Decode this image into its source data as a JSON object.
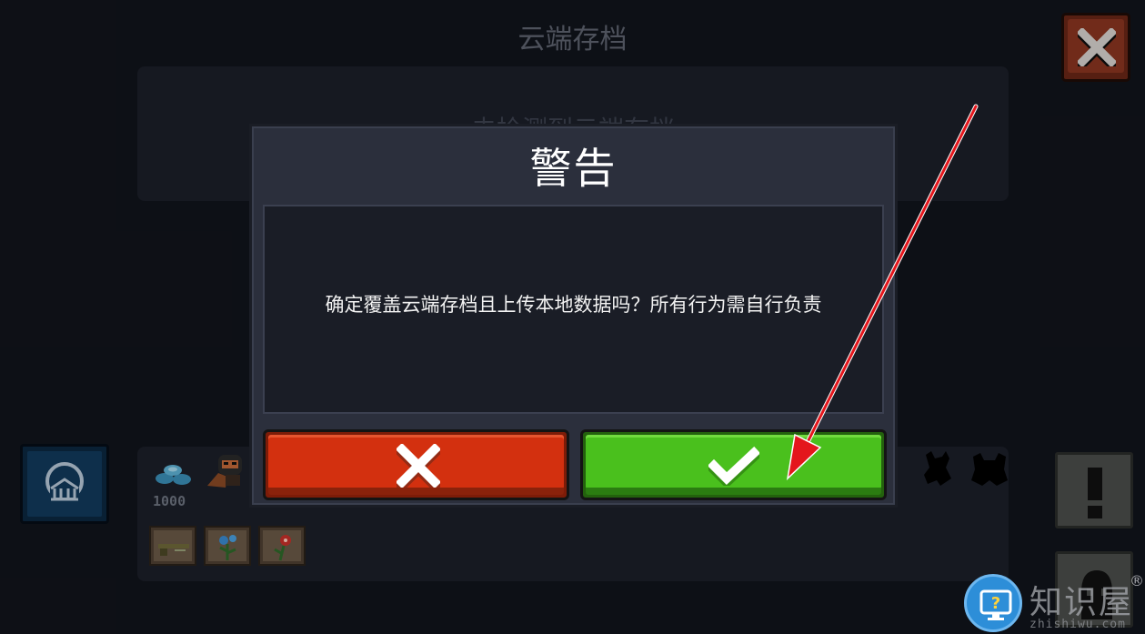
{
  "background": {
    "title": "云端存档",
    "top_panel_text": "未检测到云端存档",
    "gems_count": "1000",
    "close_icon": "close-icon",
    "side_buttons": [
      "exclamation-icon",
      "ghost-icon"
    ]
  },
  "dialog": {
    "title": "警告",
    "message": "确定覆盖云端存档且上传本地数据吗？所有行为需自行负责",
    "cancel_icon": "x-icon",
    "confirm_icon": "checkmark-icon"
  },
  "annotation": {
    "arrow_color": "#e4161c"
  },
  "watermark": {
    "text": "知识屋",
    "reg": "®",
    "sub": "zhishiwu.com"
  },
  "colors": {
    "cancel": "#d3300f",
    "confirm": "#4ac01d",
    "dialog_bg": "#2b2f3c",
    "page_bg": "#11141b"
  }
}
